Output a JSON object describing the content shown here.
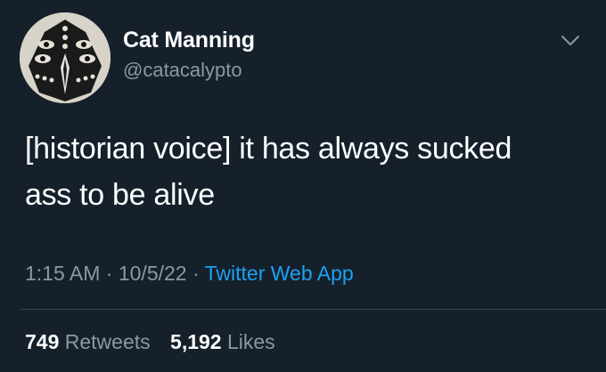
{
  "user": {
    "display_name": "Cat Manning",
    "handle": "@catacalypto",
    "avatar_icon": "avatar-image"
  },
  "menu": {
    "icon": "chevron-down-icon"
  },
  "tweet": {
    "text_lines": [
      "[historian voice] it has always sucked",
      "ass to be alive"
    ]
  },
  "meta": {
    "time": "1:15 AM",
    "separator": "·",
    "date": "10/5/22",
    "source": "Twitter Web App"
  },
  "stats": {
    "retweets_count": "749",
    "retweets_label": "Retweets",
    "likes_count": "5,192",
    "likes_label": "Likes"
  },
  "colors": {
    "background": "#15202b",
    "text_primary": "#ffffff",
    "text_secondary": "#8899a6",
    "link": "#1da1f2",
    "divider": "#38444d"
  }
}
